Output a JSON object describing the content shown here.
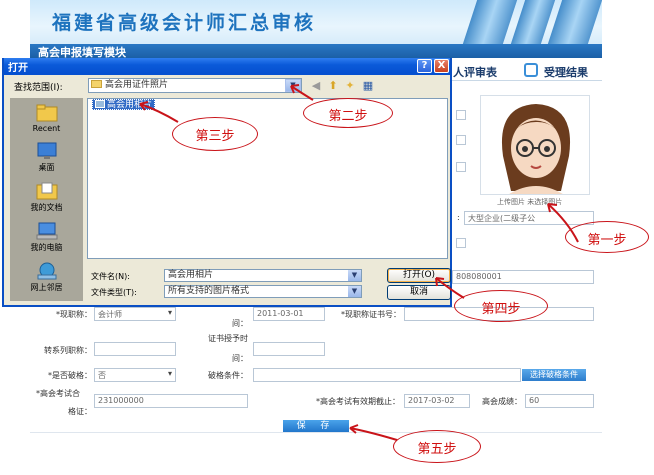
{
  "banner": {
    "title": "福建省高级会计师汇总审核"
  },
  "module": {
    "title": "高会申报填写模块"
  },
  "tabs": {
    "review_label": "人评审表",
    "result_label": "受理结果"
  },
  "photo": {
    "caption": "上传图片  未选择图片"
  },
  "form": {
    "employer_type_value": "大型企业(二级子公",
    "id_value": "808080001",
    "current_title_label": "*现职称：",
    "current_title_value": "会计师",
    "title_time_label": "间：",
    "title_date_value": "2011-03-01",
    "cert_no_label": "*现职称证书号：",
    "transfer_label": "转系列职称：",
    "cert_time_label": "证书授予时",
    "cert_time_label2": "间：",
    "exception_label": "*是否破格：",
    "exception_value": "否",
    "exception_cond_label": "破格条件：",
    "exception_btn": "选择破格条件",
    "exam_cert_label": "*高会考试合",
    "exam_cert_label2": "格证：",
    "exam_cert_value": "231000000",
    "exam_valid_label": "*高会考试有效期截止：",
    "exam_valid_value": "2017-03-02",
    "exam_score_label": "高会成绩：",
    "exam_score_value": "60",
    "save_label": "保 存"
  },
  "dialog": {
    "title": "打开",
    "help": "?",
    "close": "X",
    "look_in_label": "查找范围(I):",
    "look_in_value": "高会用证件照片",
    "places": [
      "Recent",
      "桌面",
      "我的文档",
      "我的电脑",
      "网上邻居"
    ],
    "file_item": "高会用相片",
    "filename_label": "文件名(N):",
    "filename_value": "高会用相片",
    "filetype_label": "文件类型(T):",
    "filetype_value": "所有支持的图片格式",
    "open_label": "打开(O)",
    "cancel_label": "取消"
  },
  "annotations": {
    "step1": "第一步",
    "step2": "第二步",
    "step3": "第三步",
    "step4": "第四步",
    "step5": "第五步"
  },
  "colors": {
    "accent": "#1e73be",
    "title_bar": "#0b5ad9",
    "annotation": "#d01010"
  }
}
